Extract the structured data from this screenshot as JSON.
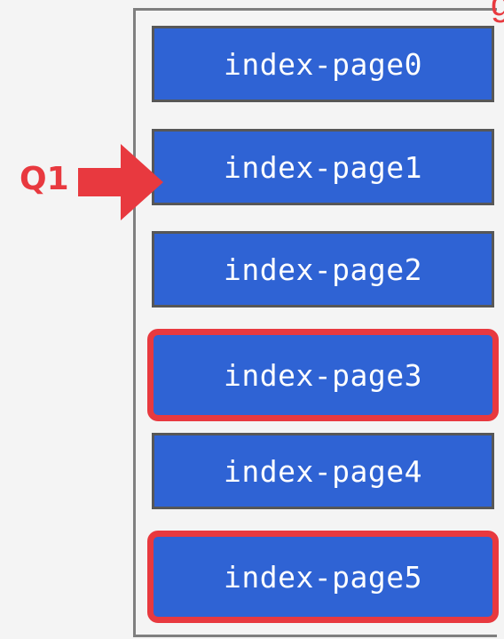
{
  "diagram": {
    "query_label": "Q1",
    "query_target_index": 1,
    "accent_color": "#e8393f",
    "page_color": "#2f63d4",
    "pages": [
      {
        "label": "index-page0",
        "highlighted": false
      },
      {
        "label": "index-page1",
        "highlighted": false
      },
      {
        "label": "index-page2",
        "highlighted": false
      },
      {
        "label": "index-page3",
        "highlighted": true
      },
      {
        "label": "index-page4",
        "highlighted": false
      },
      {
        "label": "index-page5",
        "highlighted": true
      }
    ]
  }
}
